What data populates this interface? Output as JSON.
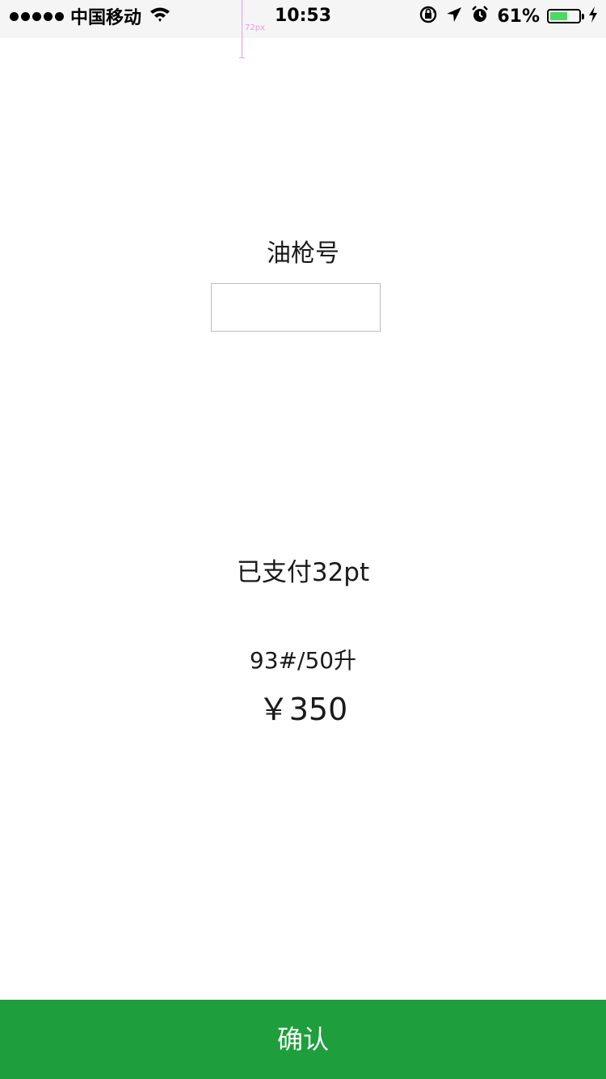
{
  "status_bar": {
    "carrier": "中国移动",
    "time": "10:53",
    "battery_percent": "61%",
    "battery_level": 0.61,
    "battery_color": "#4cd964",
    "icons": [
      "signal-dots-icon",
      "wifi-icon",
      "rotation-lock-icon",
      "location-arrow-icon",
      "alarm-clock-icon",
      "battery-icon",
      "charging-bolt-icon"
    ]
  },
  "annotation": {
    "measure_label": "72px",
    "color": "#e59be8"
  },
  "form": {
    "nozzle_label": "油枪号",
    "nozzle_value": "",
    "nozzle_placeholder": ""
  },
  "payment": {
    "paid_label": "已支付32pt",
    "fuel_info": "93#/50升",
    "amount": "￥350"
  },
  "confirm": {
    "label": "确认",
    "color": "#1e9e3c"
  }
}
